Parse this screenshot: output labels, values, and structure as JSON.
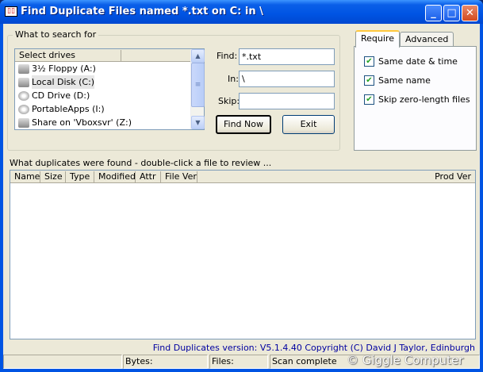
{
  "window": {
    "title": "Find Duplicate Files named *.txt on C: in \\",
    "min": "_",
    "max": "□",
    "close": "✕"
  },
  "search": {
    "group_label": "What to search for",
    "drives_header": "Select drives",
    "drives": [
      {
        "label": "3½ Floppy (A:)",
        "type": "floppy"
      },
      {
        "label": "Local Disk (C:)",
        "type": "disk",
        "selected": true
      },
      {
        "label": "CD Drive (D:)",
        "type": "cd"
      },
      {
        "label": "PortableApps (I:)",
        "type": "cd"
      },
      {
        "label": "Share on 'Vboxsvr' (Z:)",
        "type": "network"
      }
    ],
    "find_label": "Find:",
    "find_value": "*.txt",
    "in_label": "In:",
    "in_value": "\\",
    "skip_label": "Skip:",
    "skip_value": "",
    "find_now": "Find Now",
    "exit": "Exit"
  },
  "tabs": [
    {
      "label": "Require",
      "active": true
    },
    {
      "label": "Advanced"
    }
  ],
  "require": [
    {
      "label": "Same date & time",
      "checked": true
    },
    {
      "label": "Same name",
      "checked": true
    },
    {
      "label": "Skip zero-length files",
      "checked": true
    }
  ],
  "results": {
    "label": "What duplicates were found - double-click a file to review ...",
    "columns": [
      "Name",
      "Size",
      "Type",
      "Modified",
      "Attr",
      "File Ver",
      "Prod Ver"
    ]
  },
  "version": "Find Duplicates version: V5.1.4.40 Copyright (C) David J Taylor, Edinburgh",
  "status": {
    "p1": "",
    "bytes": "Bytes:",
    "files": "Files:",
    "state": "Scan complete"
  },
  "watermark": "© Giggle Computer",
  "colors": {
    "version_text": "#0000a0",
    "title_bar": "#0054e3"
  }
}
